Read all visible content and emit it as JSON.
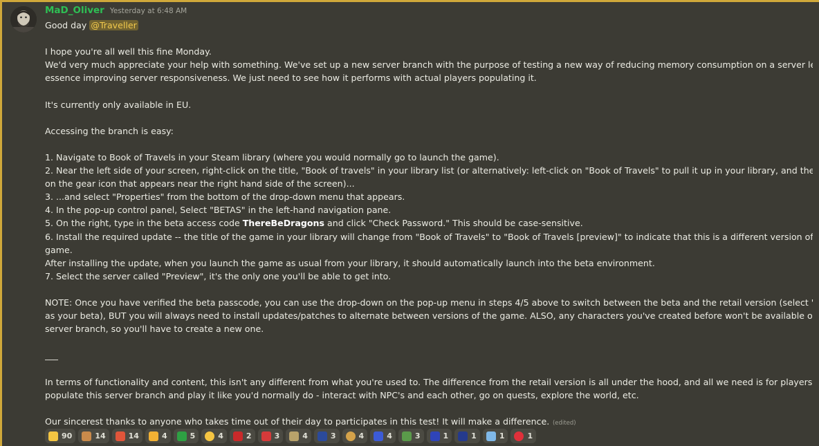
{
  "message": {
    "username": "MaD_Oliver",
    "timestamp": "Yesterday at 6:48 AM",
    "greeting_prefix": "Good day ",
    "mention": "@Traveller",
    "lines": [
      "I hope you're all well this fine Monday.",
      "We'd very much appreciate your help with something. We've set up a new server branch with the purpose of testing a new way of reducing memory consumption on a server level - in",
      "essence improving server responsiveness. We just need to see how it performs with actual players populating it.",
      "",
      "It's currently only available in EU.",
      "",
      "Accessing the branch is easy:",
      "",
      "1. Navigate to Book of Travels in your Steam library (where you would normally go to launch the game).",
      "2. Near the left side of your screen, right-click on the title, \"Book of travels\" in your library list (or alternatively: left-click on \"Book of Travels\" to pull it up in your library, and then click",
      "on the gear icon that appears near the right hand side of the screen)...",
      "3. ...and select \"Properties\" from the bottom of the drop-down menu that appears.",
      "4. In the pop-up control panel, Select \"BETAS\" in the left-hand navigation pane."
    ],
    "step5_prefix": "5. On the right, type in the beta access code ",
    "step5_code": "ThereBeDragons",
    "step5_suffix": " and click \"Check Password.\" This should be case-sensitive.",
    "lines_after": [
      "6. Install the required update -- the title of the game in your library will change from \"Book of Travels\" to \"Book of Travels [preview]\" to indicate that this is a different version of the",
      "game.",
      "After installing the update, when you launch the game as usual from your library, it should automatically launch into the beta environment.",
      "7. Select the server called \"Preview\", it's the only one you'll be able to get into.",
      "",
      "NOTE: Once you have verified the beta passcode, you can use the drop-down on the pop-up menu in steps 4/5 above to switch between the beta and the retail version (select \"None\"",
      "as your beta), BUT you will always need to install updates/patches to alternate between versions of the game. ALSO, any characters you've created before won't be available on this",
      "server branch, so you'll have to create a new one.",
      "",
      "___",
      "",
      "In terms of functionality and content, this isn't any different from what you're used to. The difference from the retail version is all under the hood, and all we need is for players to",
      "populate this server branch and play it like you'd normally do - interact with NPC's and each other, go on quests, explore the world, etc.",
      "",
      "Our sincerest thanks to anyone who takes time out of their day to participates in this test! It will make a difference."
    ],
    "edited_label": "(edited)"
  },
  "reactions": [
    {
      "icon": "thumbs-up-icon",
      "color": "#f4c542",
      "count": "90"
    },
    {
      "icon": "hand-icon",
      "color": "#c98a4b",
      "count": "14"
    },
    {
      "icon": "burst-icon",
      "color": "#e0553a",
      "count": "14"
    },
    {
      "icon": "flexed-biceps-icon",
      "color": "#f2b134",
      "count": "4"
    },
    {
      "icon": "flag-brazil-icon",
      "color": "#2ea043",
      "count": "5"
    },
    {
      "icon": "cheese-icon",
      "color": "#f5c542",
      "count": "4"
    },
    {
      "icon": "flag-taiwan-icon",
      "color": "#c92a2a",
      "count": "2"
    },
    {
      "icon": "flag-canada-icon",
      "color": "#d63a3a",
      "count": "3"
    },
    {
      "icon": "custom-emoji-icon",
      "color": "#b8a26a",
      "count": "4"
    },
    {
      "icon": "flag-uk-icon",
      "color": "#2b4a9b",
      "count": "3"
    },
    {
      "icon": "potato-icon",
      "color": "#d4a24a",
      "count": "4"
    },
    {
      "icon": "flag-france-icon",
      "color": "#3c5bd6",
      "count": "4"
    },
    {
      "icon": "money-icon",
      "color": "#5a9a4a",
      "count": "3"
    },
    {
      "icon": "flag-eu-icon",
      "color": "#2f44b8",
      "count": "1"
    },
    {
      "icon": "flag-australia-icon",
      "color": "#253a8c",
      "count": "1"
    },
    {
      "icon": "flag-argentina-icon",
      "color": "#7fb8e8",
      "count": "1"
    },
    {
      "icon": "heart-icon",
      "color": "#e0303a",
      "count": "1"
    }
  ]
}
